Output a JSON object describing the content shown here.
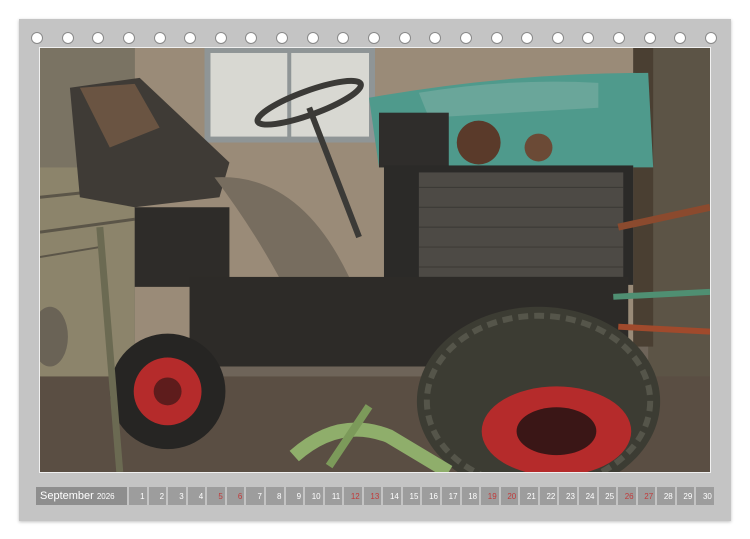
{
  "calendar": {
    "month": "September",
    "year": "2026",
    "days": [
      {
        "num": "1",
        "weekend": false
      },
      {
        "num": "2",
        "weekend": false
      },
      {
        "num": "3",
        "weekend": false
      },
      {
        "num": "4",
        "weekend": false
      },
      {
        "num": "5",
        "weekend": true
      },
      {
        "num": "6",
        "weekend": true
      },
      {
        "num": "7",
        "weekend": false
      },
      {
        "num": "8",
        "weekend": false
      },
      {
        "num": "9",
        "weekend": false
      },
      {
        "num": "10",
        "weekend": false
      },
      {
        "num": "11",
        "weekend": false
      },
      {
        "num": "12",
        "weekend": true
      },
      {
        "num": "13",
        "weekend": true
      },
      {
        "num": "14",
        "weekend": false
      },
      {
        "num": "15",
        "weekend": false
      },
      {
        "num": "16",
        "weekend": false
      },
      {
        "num": "17",
        "weekend": false
      },
      {
        "num": "18",
        "weekend": false
      },
      {
        "num": "19",
        "weekend": true
      },
      {
        "num": "20",
        "weekend": true
      },
      {
        "num": "21",
        "weekend": false
      },
      {
        "num": "22",
        "weekend": false
      },
      {
        "num": "23",
        "weekend": false
      },
      {
        "num": "24",
        "weekend": false
      },
      {
        "num": "25",
        "weekend": false
      },
      {
        "num": "26",
        "weekend": true
      },
      {
        "num": "27",
        "weekend": true
      },
      {
        "num": "28",
        "weekend": false
      },
      {
        "num": "29",
        "weekend": false
      },
      {
        "num": "30",
        "weekend": false
      }
    ]
  },
  "binding_holes": 23,
  "colors": {
    "page": "#c4c4c4",
    "month_box": "#8e8e8e",
    "day_box": "#9d9d9d",
    "weekend_text": "#c23a3a",
    "tractor_teal": "#4f9a8c",
    "rim_red": "#b52b2b"
  }
}
